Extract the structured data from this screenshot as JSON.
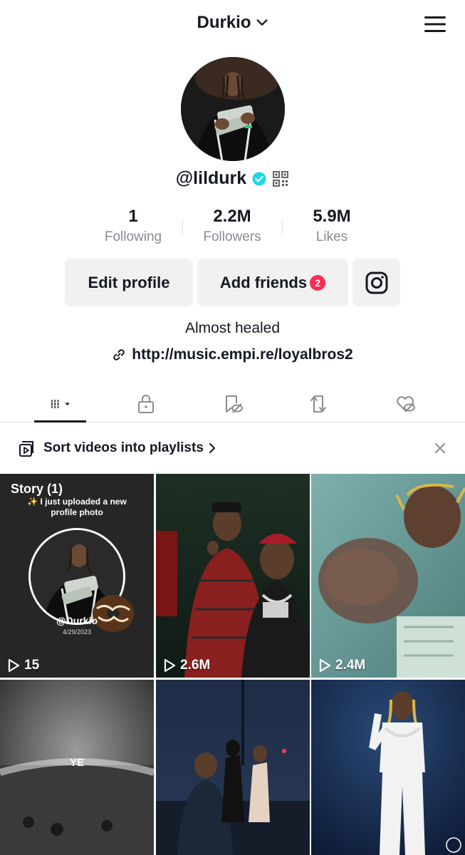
{
  "header": {
    "account_name": "Durkio",
    "icons": {
      "dropdown": "chevron-down-icon",
      "menu": "hamburger-menu-icon"
    }
  },
  "profile": {
    "username": "@lildurk",
    "verified": true,
    "stats": [
      {
        "value": "1",
        "label": "Following"
      },
      {
        "value": "2.2M",
        "label": "Followers"
      },
      {
        "value": "5.9M",
        "label": "Likes"
      }
    ],
    "buttons": {
      "edit_profile": "Edit profile",
      "add_friends": "Add friends",
      "add_friends_badge": "2"
    },
    "bio": "Almost healed",
    "link": "http://music.empi.re/loyalbros2"
  },
  "tabs": [
    {
      "name": "videos",
      "icon": "grid-icon",
      "active": true
    },
    {
      "name": "private",
      "icon": "lock-icon"
    },
    {
      "name": "favorites",
      "icon": "bookmark-hidden-icon"
    },
    {
      "name": "reposts",
      "icon": "repost-icon"
    },
    {
      "name": "liked",
      "icon": "heart-hidden-icon"
    }
  ],
  "playlist_prompt": {
    "text": "Sort videos into playlists"
  },
  "videos": [
    {
      "views": "15",
      "story_title": "Story (1)",
      "story_text": "✨ I just uploaded a new profile photo",
      "story_handle": "@Durkio",
      "story_date": "4/29/2023"
    },
    {
      "views": "2.6M"
    },
    {
      "views": "2.4M"
    },
    {
      "views": "",
      "overlay_text": "YE"
    },
    {
      "views": ""
    },
    {
      "views": ""
    }
  ],
  "colors": {
    "accent_red": "#fe2c55",
    "verified_blue": "#20d5ec",
    "text": "#161823",
    "muted": "#8a8b91"
  }
}
